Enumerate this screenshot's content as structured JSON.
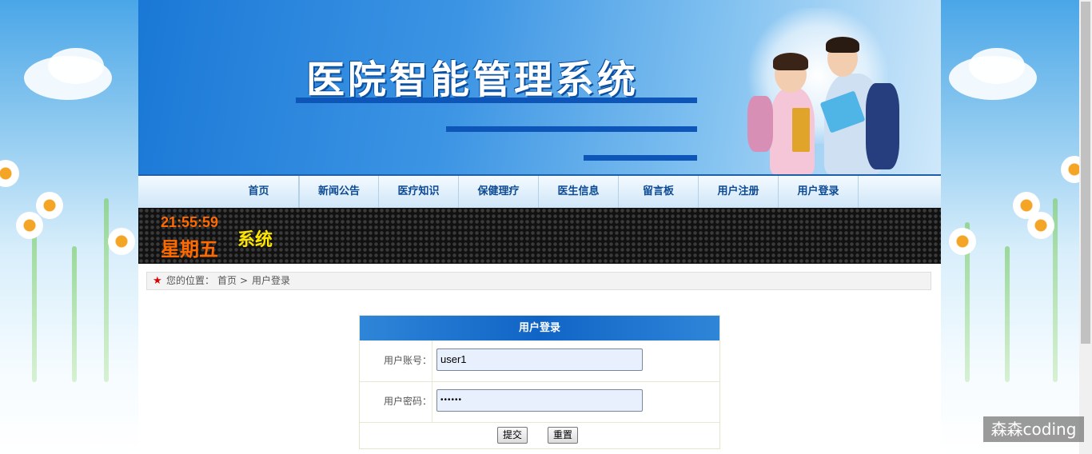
{
  "banner": {
    "title": "医院智能管理系统"
  },
  "nav": {
    "items": [
      {
        "label": "首页"
      },
      {
        "label": "新闻公告"
      },
      {
        "label": "医疗知识"
      },
      {
        "label": "保健理疗"
      },
      {
        "label": "医生信息"
      },
      {
        "label": "留言板"
      },
      {
        "label": "用户注册"
      },
      {
        "label": "用户登录"
      }
    ]
  },
  "clock": {
    "time": "21:55:59",
    "weekday": "星期五",
    "system_text": "系统"
  },
  "breadcrumb": {
    "prefix": "您的位置：",
    "home": "首页",
    "separator": ">",
    "current": "用户登录"
  },
  "login": {
    "title": "用户登录",
    "account_label": "用户账号：",
    "account_value": "user1",
    "password_label": "用户密码：",
    "password_value": "••••••",
    "submit_label": "提交",
    "reset_label": "重置"
  },
  "watermark": "森森coding",
  "colors": {
    "nav_text": "#0c4a94",
    "clock_text": "#ff6a00",
    "system_text": "#ffe600",
    "login_header": "#1064c6"
  }
}
